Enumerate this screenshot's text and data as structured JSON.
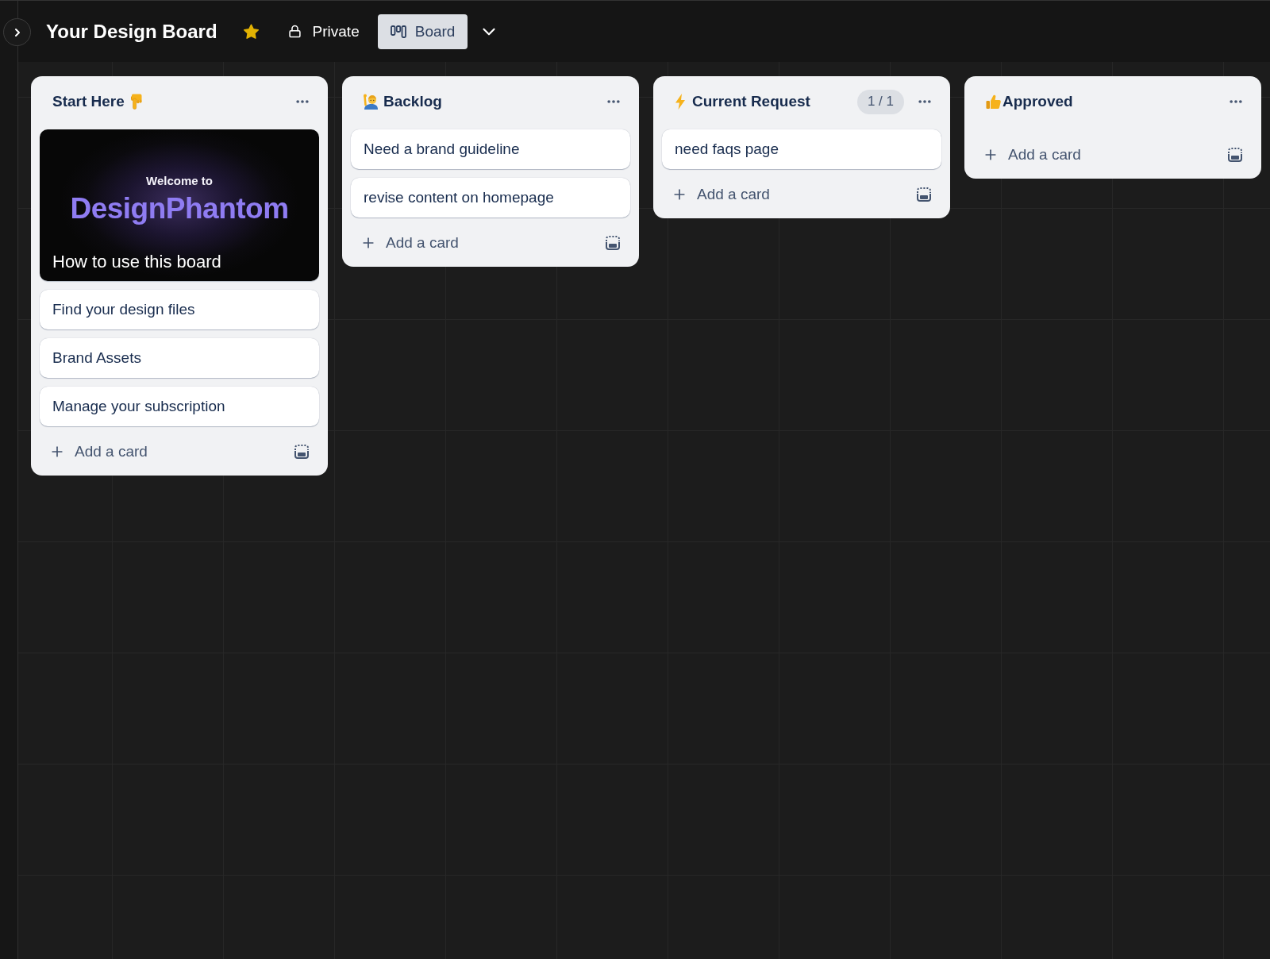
{
  "sidebar": {
    "expanded": false
  },
  "header": {
    "title": "Your Design Board",
    "starred": true,
    "visibility": "Private",
    "views": [
      {
        "label": "Board",
        "selected": true
      }
    ]
  },
  "lists": [
    {
      "title": "Start Here",
      "kind": "point-down",
      "cards": [
        {
          "kind": "cover",
          "welcome": "Welcome to",
          "logo": "DesignPhantom",
          "title": "How to use this board"
        },
        {
          "kind": "plain",
          "title": "Find your design files"
        },
        {
          "kind": "plain",
          "title": "Brand Assets"
        },
        {
          "kind": "plain",
          "title": "Manage your subscription"
        }
      ],
      "add_label": "Add a card"
    },
    {
      "title": "Backlog",
      "kind": "raising-hand",
      "cards": [
        {
          "kind": "plain",
          "title": "Need a brand guideline"
        },
        {
          "kind": "plain",
          "title": "revise content on homepage"
        }
      ],
      "add_label": "Add a card"
    },
    {
      "title": "Current Request",
      "kind": "zap",
      "count": "1 / 1",
      "cards": [
        {
          "kind": "plain",
          "title": "need faqs page"
        }
      ],
      "add_label": "Add a card"
    },
    {
      "title": "Approved",
      "kind": "thumbs-up",
      "add_label": "Add a card"
    }
  ]
}
